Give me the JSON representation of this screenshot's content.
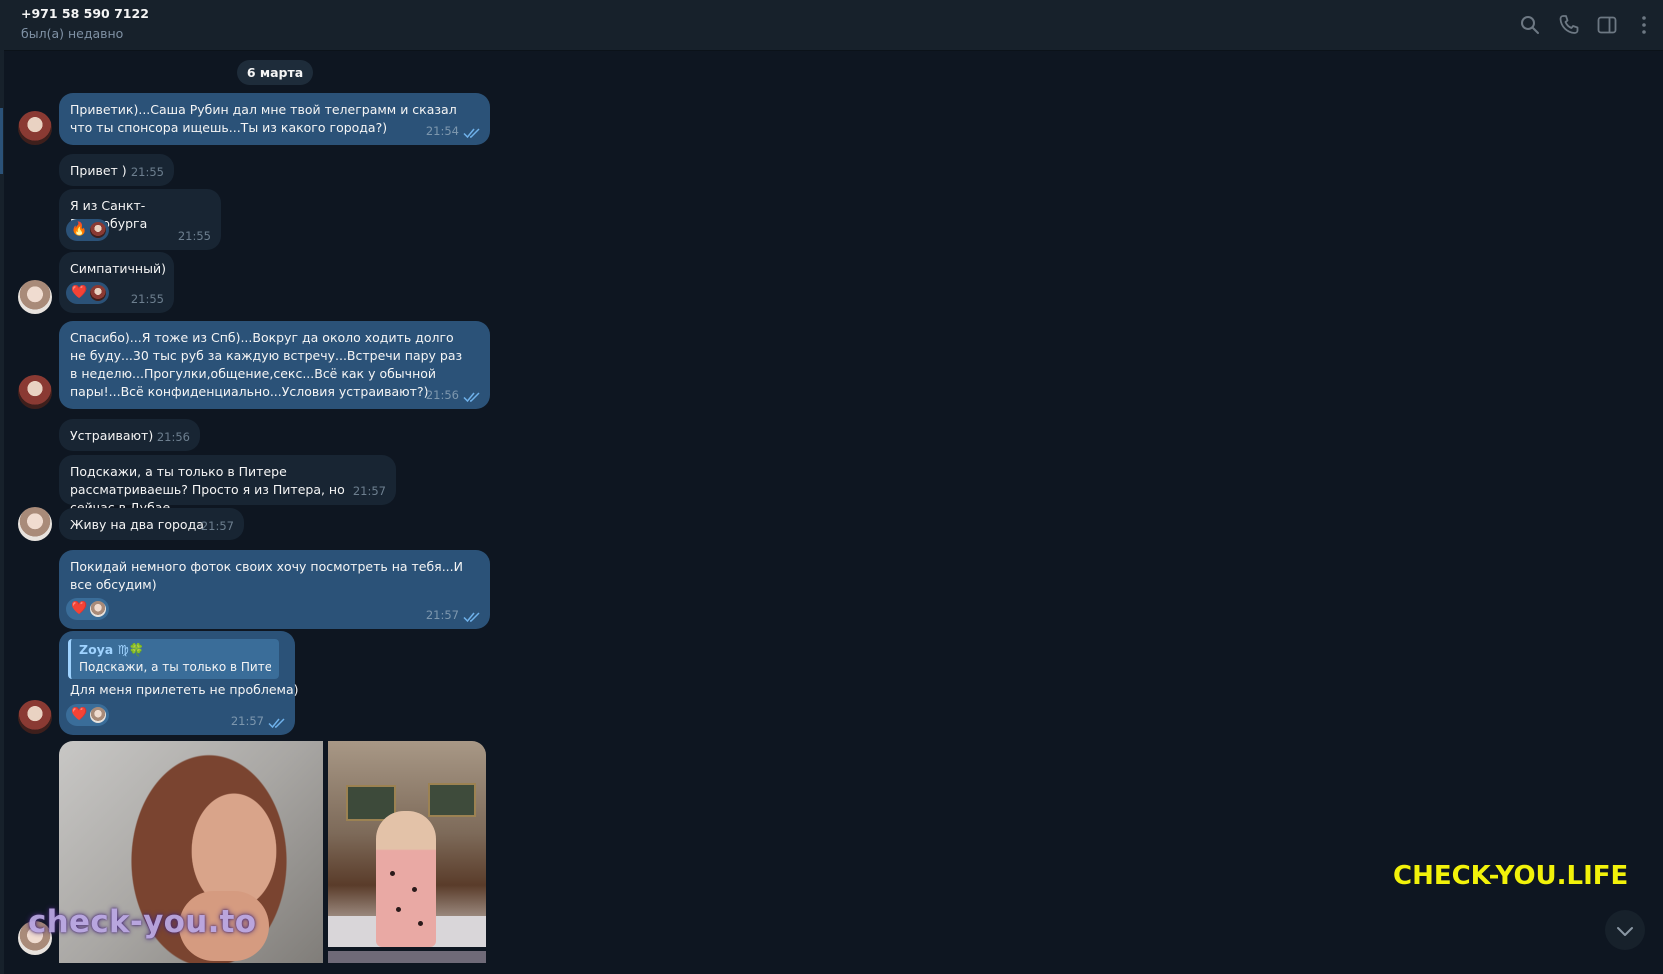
{
  "header": {
    "title": "+971 58 590 7122",
    "status": "был(а) недавно",
    "icons": [
      "search-icon",
      "phone-icon",
      "sidebar-toggle-icon",
      "more-vert-icon"
    ]
  },
  "date_separator": "6 марта",
  "messages": [
    {
      "dir": "out",
      "text": "Приветик)...Саша Рубин дал мне твой телеграмм и сказал что ты спонсора ищешь...Ты из какого города?)",
      "time": "21:54",
      "read": true
    },
    {
      "dir": "in",
      "text": "Привет )",
      "time": "21:55"
    },
    {
      "dir": "in",
      "text": "Я из Санкт-Петербурга",
      "time": "21:55",
      "reaction": "🔥"
    },
    {
      "dir": "in",
      "text": "Симпатичный)",
      "time": "21:55",
      "reaction": "❤️"
    },
    {
      "dir": "out",
      "text": "Спасибо)...Я тоже из Спб)...Вокруг да около ходить долго не буду...30 тыс руб за каждую встречу...Встречи пару раз в неделю...Прогулки,общение,секс...Всё как у обычной пары!...Всё конфиденциально...Условия устраивают?)",
      "time": "21:56",
      "read": true
    },
    {
      "dir": "in",
      "text": "Устраивают)",
      "time": "21:56"
    },
    {
      "dir": "in",
      "text": "Подскажи, а ты только в Питере рассматриваешь? Просто я из Питера, но сейчас в Дубае",
      "time": "21:57"
    },
    {
      "dir": "in",
      "text": "Живу на два города",
      "time": "21:57"
    },
    {
      "dir": "out",
      "text": "Покидай немного фоток своих хочу посмотреть на тебя...И все обсудим)",
      "time": "21:57",
      "read": true,
      "reaction": "❤️"
    },
    {
      "dir": "out",
      "reply_name": "Zoya ♍🍀",
      "reply_text": "Подскажи, а ты только в Пите...",
      "text": "Для меня прилететь не проблема)",
      "time": "21:57",
      "read": true,
      "reaction": "❤️"
    }
  ],
  "watermarks": {
    "left": "check-you.to",
    "right": "CHECK-YOU.LIFE"
  },
  "colors": {
    "background": "#0e1621",
    "header": "#17212b",
    "outgoing_bubble": "#2b5278",
    "incoming_bubble": "#182533",
    "watermark_yellow": "#f2f20a"
  }
}
